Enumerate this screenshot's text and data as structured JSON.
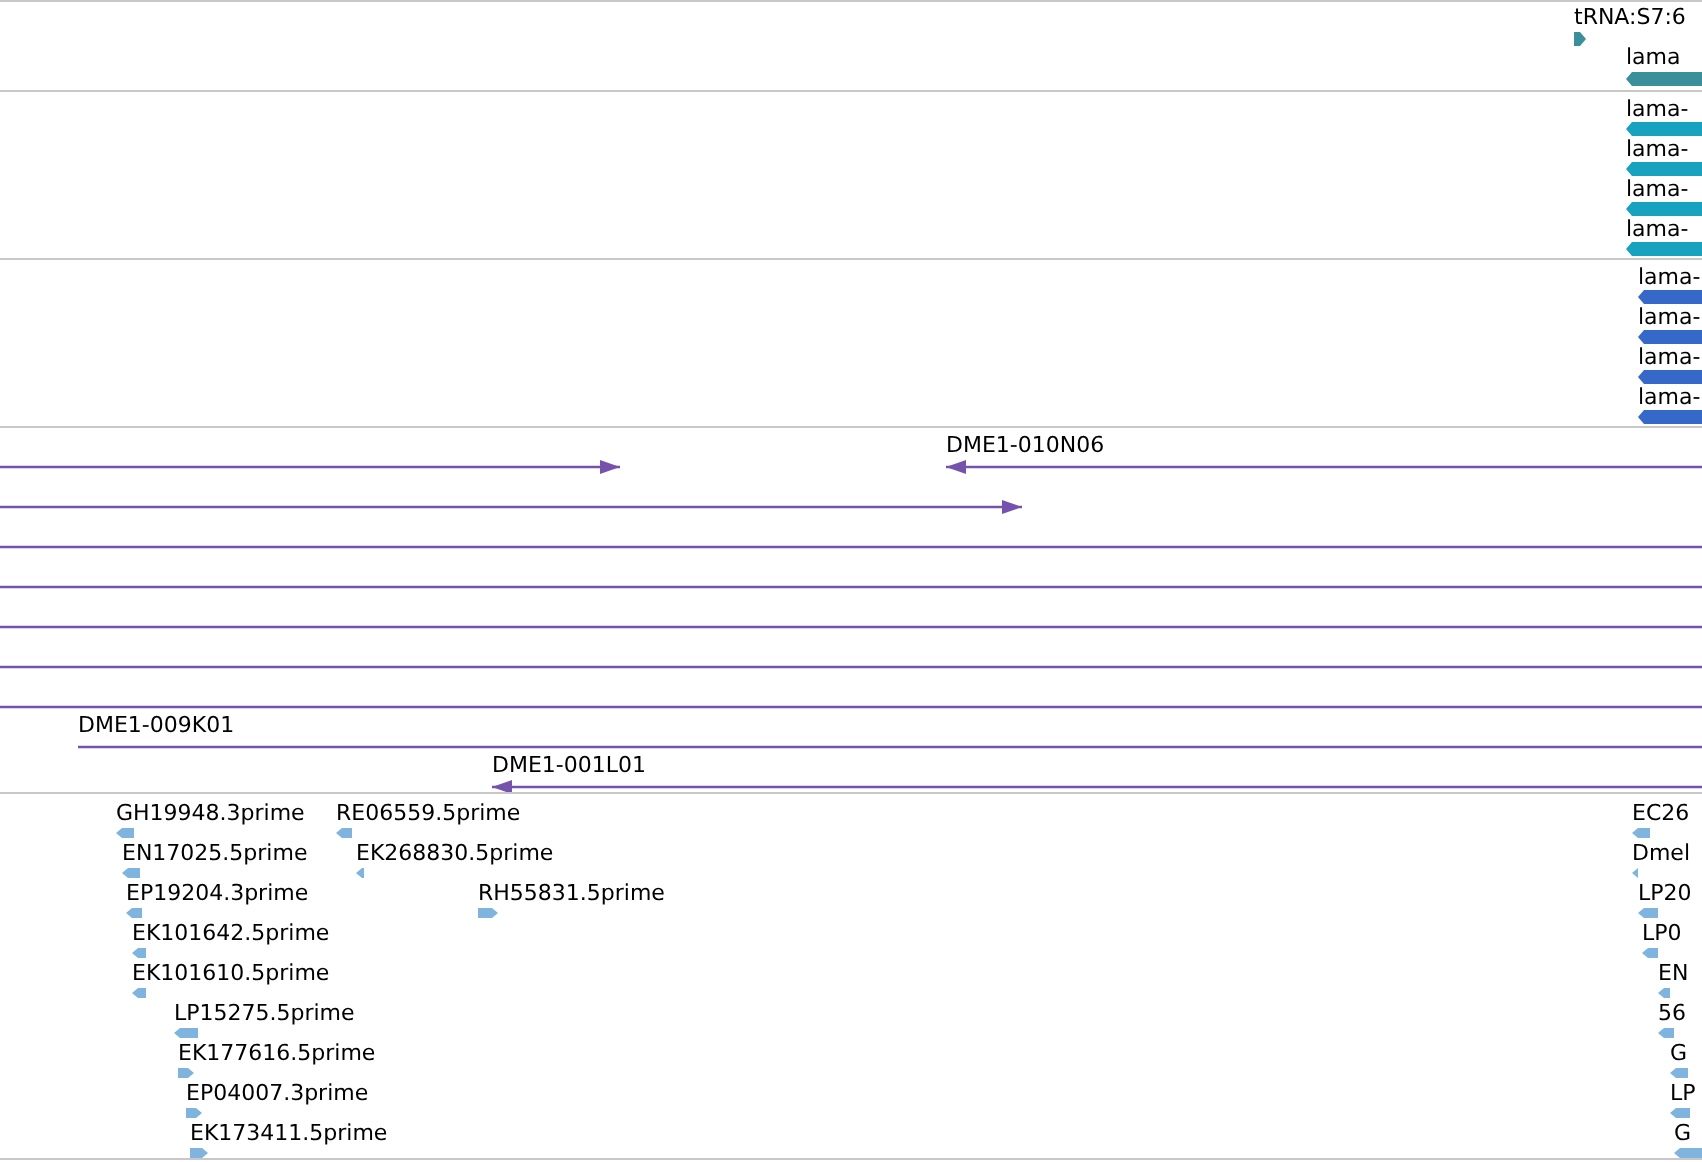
{
  "tracks": [
    {
      "kind": "gene",
      "color": "#3a8f9a",
      "features": [
        {
          "label": "tRNA:S7:6",
          "kind": "forward"
        },
        {
          "label": "lama",
          "kind": "reverse"
        }
      ]
    },
    {
      "kind": "gene",
      "color": "#17a2c0",
      "features": [
        {
          "label": "lama-",
          "kind": "reverse"
        },
        {
          "label": "lama-",
          "kind": "reverse"
        },
        {
          "label": "lama-",
          "kind": "reverse"
        },
        {
          "label": "lama-",
          "kind": "reverse"
        }
      ]
    },
    {
      "kind": "gene",
      "color": "#3568c9",
      "features": [
        {
          "label": "lama-",
          "kind": "reverse"
        },
        {
          "label": "lama-",
          "kind": "reverse"
        },
        {
          "label": "lama-",
          "kind": "reverse"
        },
        {
          "label": "lama-",
          "kind": "reverse"
        }
      ]
    },
    {
      "kind": "clone",
      "color": "#7553ac",
      "features": [
        {
          "kind": "forward"
        },
        {
          "label": "DME1-010N06",
          "kind": "reverse"
        },
        {
          "kind": "forward"
        },
        {
          "kind": "plain"
        },
        {
          "kind": "plain"
        },
        {
          "kind": "plain"
        },
        {
          "kind": "plain"
        },
        {
          "kind": "plain"
        },
        {
          "label": "DME1-009K01",
          "kind": "forward"
        },
        {
          "label": "DME1-001L01",
          "kind": "reverse"
        }
      ]
    },
    {
      "kind": "est",
      "color": "#7fb4de",
      "features": [
        {
          "label": "GH19948.3prime",
          "kind": "reverse"
        },
        {
          "label": "RE06559.5prime",
          "kind": "reverse"
        },
        {
          "label": "EN17025.5prime",
          "kind": "reverse"
        },
        {
          "label": "EK268830.5prime",
          "kind": "reverse"
        },
        {
          "label": "EP19204.3prime",
          "kind": "reverse"
        },
        {
          "label": "RH55831.5prime",
          "kind": "forward"
        },
        {
          "label": "EK101642.5prime",
          "kind": "reverse"
        },
        {
          "label": "EK101610.5prime",
          "kind": "reverse"
        },
        {
          "label": "LP15275.5prime",
          "kind": "reverse"
        },
        {
          "label": "EK177616.5prime",
          "kind": "forward"
        },
        {
          "label": "EP04007.3prime",
          "kind": "forward"
        },
        {
          "label": "EK173411.5prime",
          "kind": "forward"
        },
        {
          "label": "EC26",
          "kind": "reverse"
        },
        {
          "label": "Dmel",
          "kind": "reverse"
        },
        {
          "label": "LP20",
          "kind": "reverse"
        },
        {
          "label": "LP0",
          "kind": "reverse"
        },
        {
          "label": "EN",
          "kind": "reverse"
        },
        {
          "label": "56",
          "kind": "reverse"
        },
        {
          "label": "G",
          "kind": "reverse"
        },
        {
          "label": "LP",
          "kind": "reverse"
        },
        {
          "label": "G",
          "kind": "reverse"
        }
      ]
    }
  ]
}
